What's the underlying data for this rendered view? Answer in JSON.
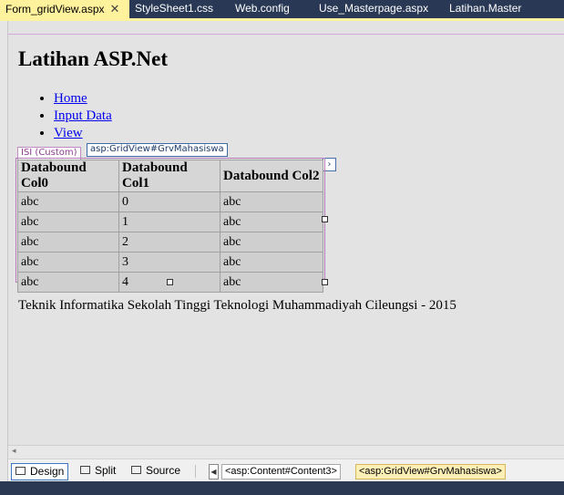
{
  "tabs": [
    {
      "label": "Form_gridView.aspx",
      "active": true,
      "close": "✕"
    },
    {
      "label": "StyleSheet1.css"
    },
    {
      "label": "Web.config"
    },
    {
      "label": "Use_Masterpage.aspx"
    },
    {
      "label": "Latihan.Master"
    }
  ],
  "page": {
    "title": "Latihan ASP.Net",
    "nav": [
      "Home",
      "Input Data",
      "View"
    ],
    "footer": "Teknik Informatika Sekolah Tinggi Teknologi Muhammadiyah Cileungsi - 2015"
  },
  "smart_tags": {
    "content": "ISI (Custom)",
    "grid": "asp:GridView#GrvMahasiswa",
    "arrow": "›"
  },
  "grid": {
    "headers": [
      "Databound Col0",
      "Databound Col1",
      "Databound Col2"
    ],
    "rows": [
      [
        "abc",
        "0",
        "abc"
      ],
      [
        "abc",
        "1",
        "abc"
      ],
      [
        "abc",
        "2",
        "abc"
      ],
      [
        "abc",
        "3",
        "abc"
      ],
      [
        "abc",
        "4",
        "abc"
      ]
    ]
  },
  "bottom": {
    "design": "Design",
    "split": "Split",
    "source": "Source",
    "crumbs": [
      "<asp:Content#Content3>",
      "<asp:GridView#GrvMahasiswa>"
    ]
  },
  "icons": {
    "scroll_left": "◂",
    "crumb_prev": "◀"
  },
  "colors": {
    "active_tab": "#fff29d",
    "tab_bar": "#293955",
    "link": "#0000ee",
    "selection": "#b57bbb"
  }
}
